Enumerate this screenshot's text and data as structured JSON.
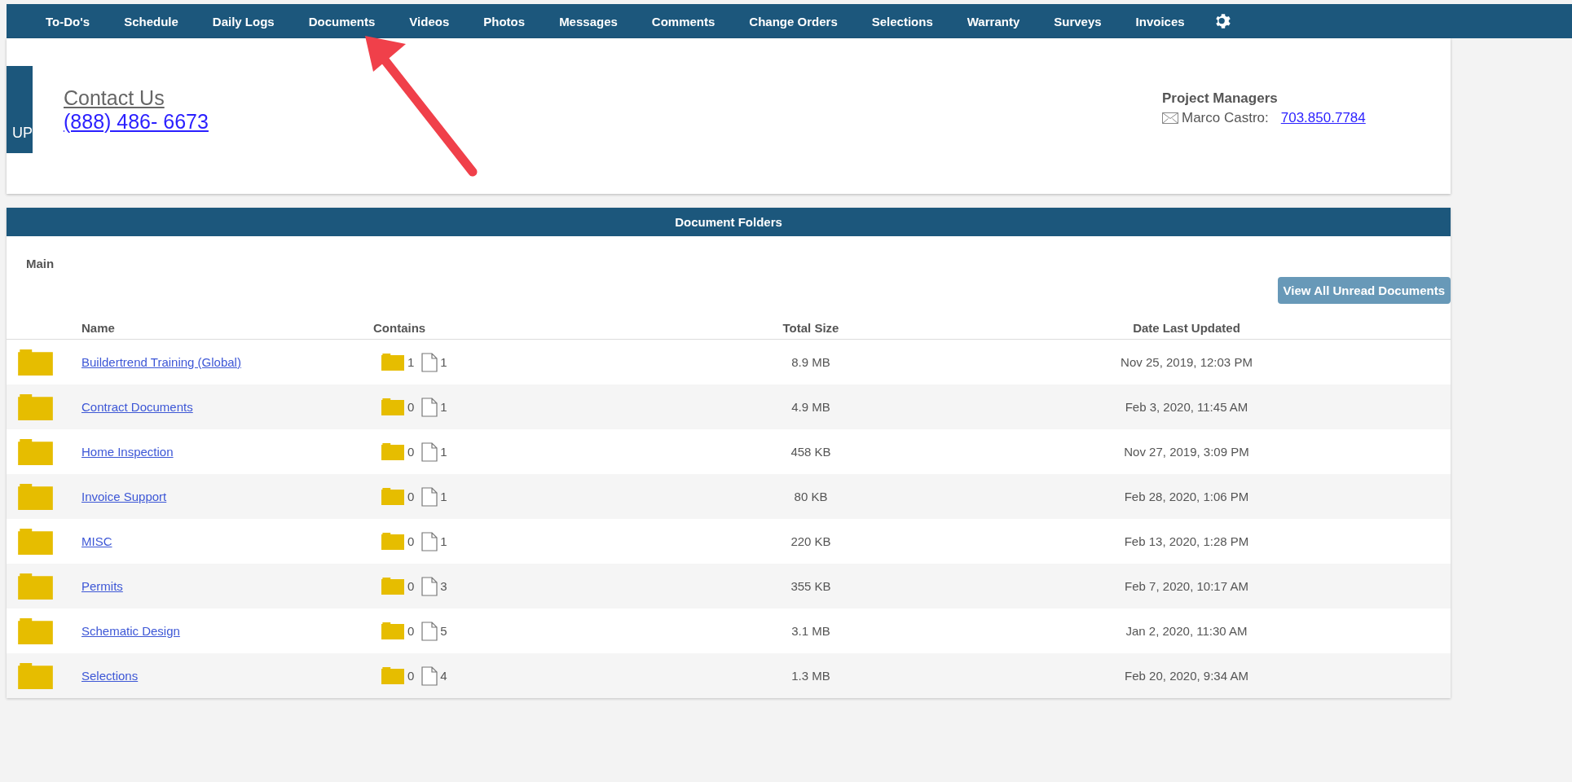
{
  "nav": {
    "items": [
      "To-Do's",
      "Schedule",
      "Daily Logs",
      "Documents",
      "Videos",
      "Photos",
      "Messages",
      "Comments",
      "Change Orders",
      "Selections",
      "Warranty",
      "Surveys",
      "Invoices"
    ]
  },
  "header": {
    "logo_text": "UP",
    "contact_title": "Contact Us",
    "contact_phone": "(888) 486- 6673",
    "managers_title": "Project Managers",
    "manager_name": "Marco Castro:",
    "manager_phone": "703.850.7784"
  },
  "documents": {
    "title": "Document Folders",
    "breadcrumb": "Main",
    "unread_button": "View All Unread Documents",
    "columns": [
      "Name",
      "Contains",
      "Total Size",
      "Date Last Updated"
    ],
    "rows": [
      {
        "name": "Buildertrend Training (Global)",
        "folders": "1",
        "files": "1",
        "size": "8.9 MB",
        "updated": "Nov 25, 2019, 12:03 PM"
      },
      {
        "name": "Contract Documents",
        "folders": "0",
        "files": "1",
        "size": "4.9 MB",
        "updated": "Feb 3, 2020, 11:45 AM"
      },
      {
        "name": "Home Inspection",
        "folders": "0",
        "files": "1",
        "size": "458 KB",
        "updated": "Nov 27, 2019, 3:09 PM"
      },
      {
        "name": "Invoice Support",
        "folders": "0",
        "files": "1",
        "size": "80 KB",
        "updated": "Feb 28, 2020, 1:06 PM"
      },
      {
        "name": "MISC",
        "folders": "0",
        "files": "1",
        "size": "220 KB",
        "updated": "Feb 13, 2020, 1:28 PM"
      },
      {
        "name": "Permits",
        "folders": "0",
        "files": "3",
        "size": "355 KB",
        "updated": "Feb 7, 2020, 10:17 AM"
      },
      {
        "name": "Schematic Design",
        "folders": "0",
        "files": "5",
        "size": "3.1 MB",
        "updated": "Jan 2, 2020, 11:30 AM"
      },
      {
        "name": "Selections",
        "folders": "0",
        "files": "4",
        "size": "1.3 MB",
        "updated": "Feb 20, 2020, 9:34 AM"
      }
    ]
  }
}
